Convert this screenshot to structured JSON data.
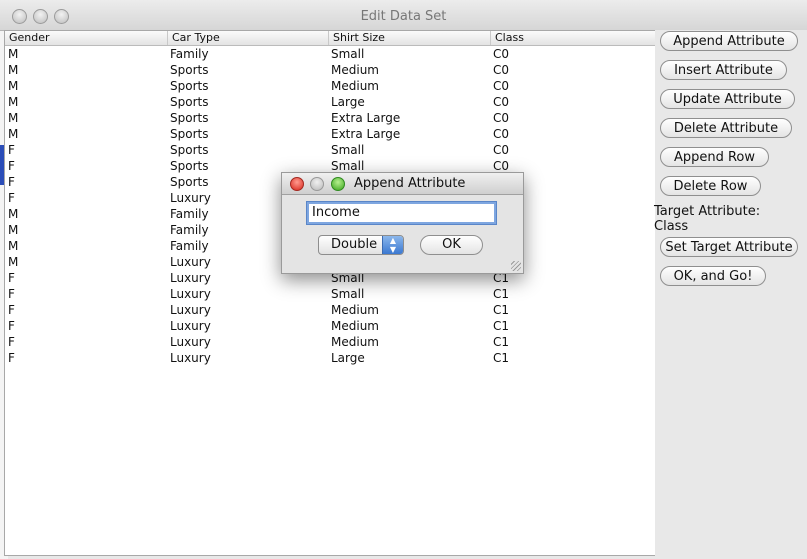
{
  "window": {
    "title": "Edit Data Set"
  },
  "table": {
    "columns": [
      "Gender",
      "Car Type",
      "Shirt Size",
      "Class"
    ],
    "rows": [
      [
        "M",
        "Family",
        "Small",
        "C0"
      ],
      [
        "M",
        "Sports",
        "Medium",
        "C0"
      ],
      [
        "M",
        "Sports",
        "Medium",
        "C0"
      ],
      [
        "M",
        "Sports",
        "Large",
        "C0"
      ],
      [
        "M",
        "Sports",
        "Extra Large",
        "C0"
      ],
      [
        "M",
        "Sports",
        "Extra Large",
        "C0"
      ],
      [
        "F",
        "Sports",
        "Small",
        "C0"
      ],
      [
        "F",
        "Sports",
        "Small",
        "C0"
      ],
      [
        "F",
        "Sports",
        "",
        ""
      ],
      [
        "F",
        "Luxury",
        "",
        ""
      ],
      [
        "M",
        "Family",
        "",
        ""
      ],
      [
        "M",
        "Family",
        "",
        ""
      ],
      [
        "M",
        "Family",
        "",
        ""
      ],
      [
        "M",
        "Luxury",
        "",
        ""
      ],
      [
        "F",
        "Luxury",
        "Small",
        "C1"
      ],
      [
        "F",
        "Luxury",
        "Small",
        "C1"
      ],
      [
        "F",
        "Luxury",
        "Medium",
        "C1"
      ],
      [
        "F",
        "Luxury",
        "Medium",
        "C1"
      ],
      [
        "F",
        "Luxury",
        "Medium",
        "C1"
      ],
      [
        "F",
        "Luxury",
        "Large",
        "C1"
      ]
    ]
  },
  "panel": {
    "append_attribute": "Append Attribute",
    "insert_attribute": "Insert Attribute",
    "update_attribute": "Update Attribute",
    "delete_attribute": "Delete Attribute",
    "append_row": "Append Row",
    "delete_row": "Delete Row",
    "target_label": "Target Attribute:",
    "target_value": "Class",
    "set_target": "Set Target Attribute",
    "ok_go": "OK, and Go!"
  },
  "dialog": {
    "title": "Append Attribute",
    "input_value": "Income",
    "type_selected": "Double",
    "ok_label": "OK"
  }
}
